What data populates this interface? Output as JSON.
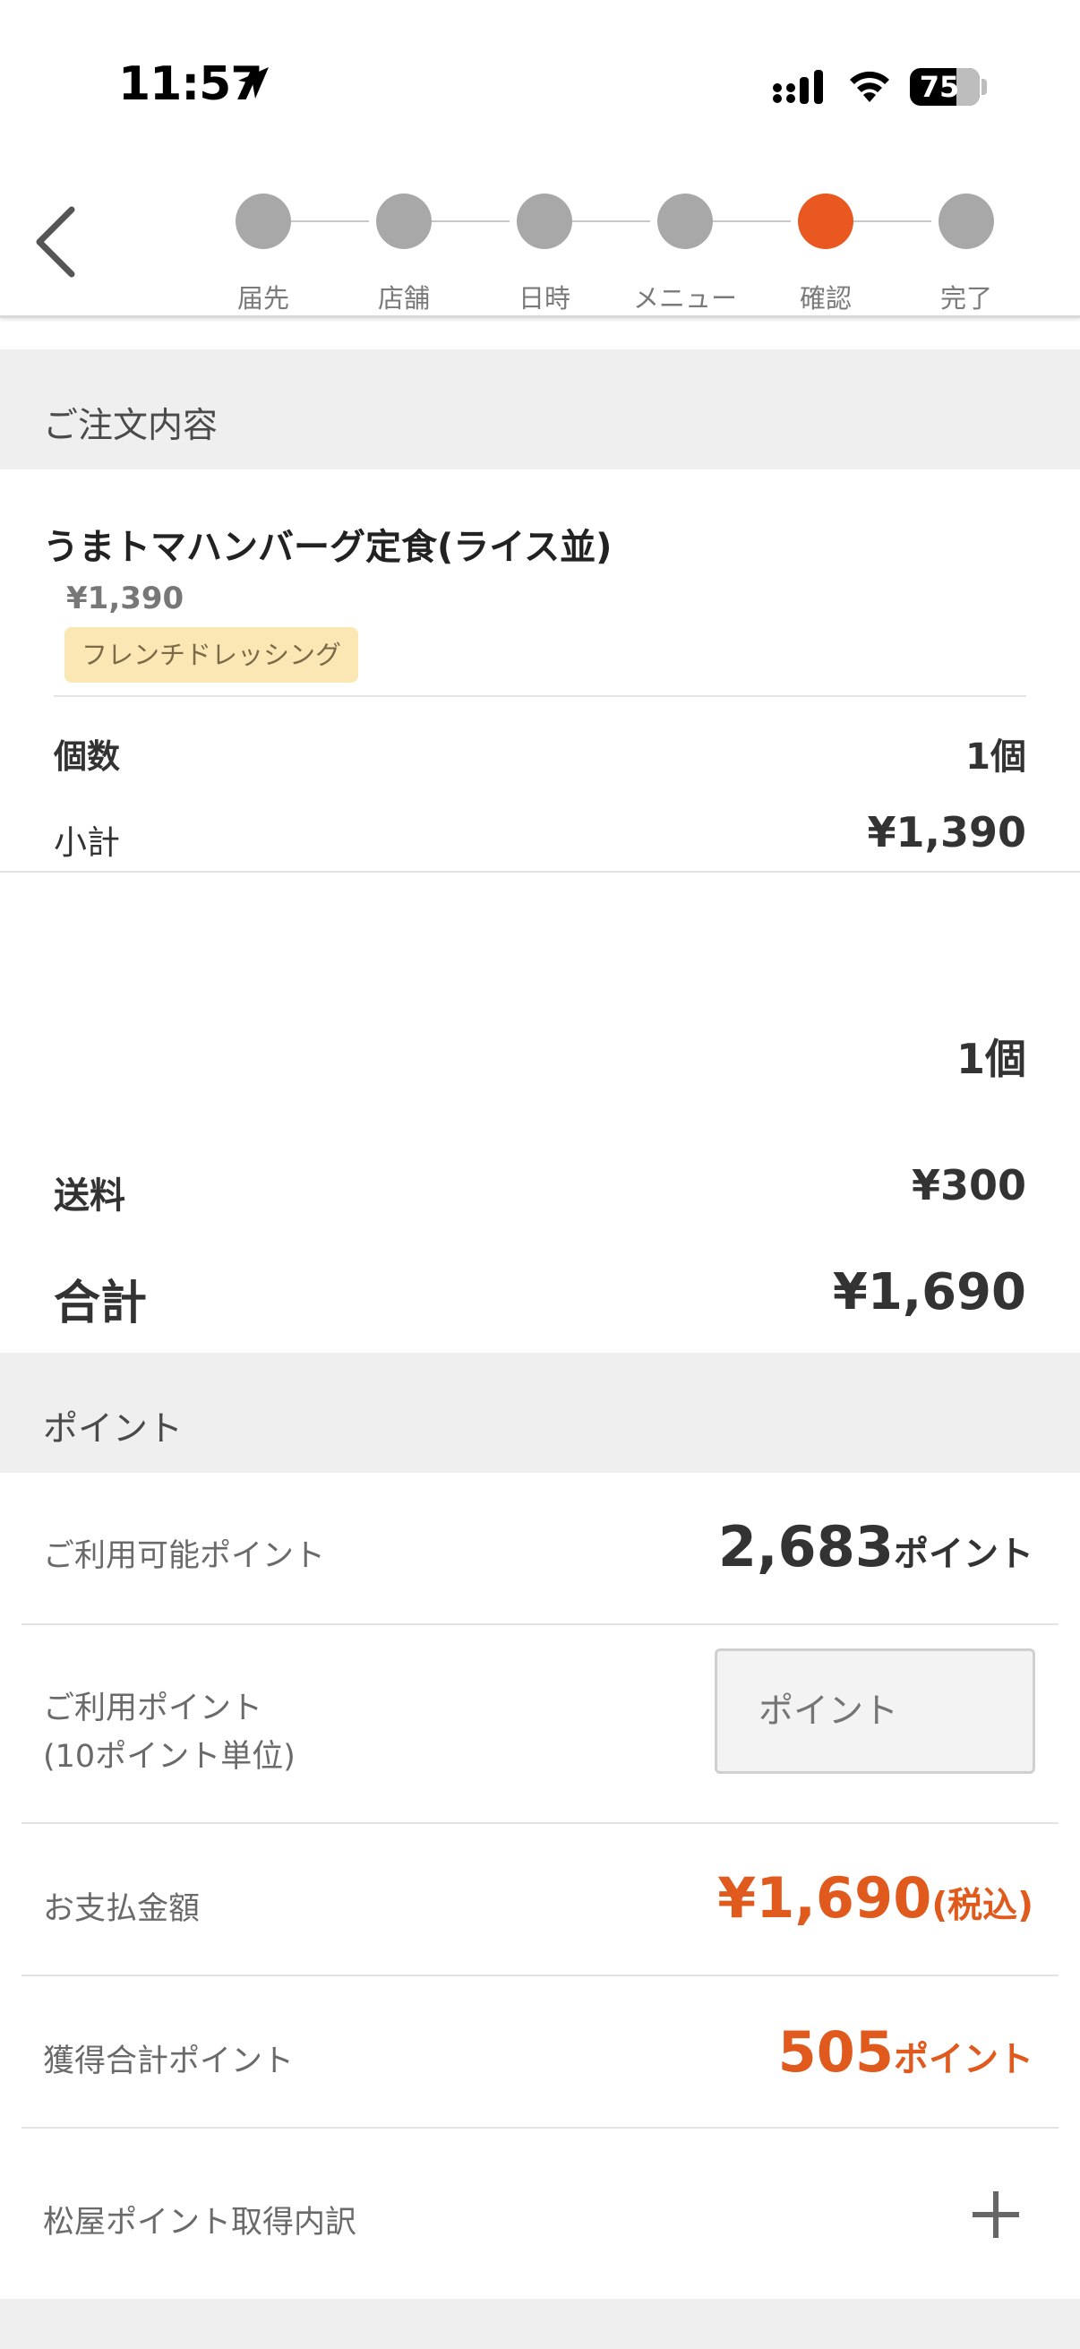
{
  "status_bar": {
    "time": "11:57",
    "battery": "75"
  },
  "stepper": {
    "steps": [
      {
        "label": "届先",
        "active": false
      },
      {
        "label": "店舗",
        "active": false
      },
      {
        "label": "日時",
        "active": false
      },
      {
        "label": "メニュー",
        "active": false
      },
      {
        "label": "確認",
        "active": true
      },
      {
        "label": "完了",
        "active": false
      }
    ]
  },
  "order": {
    "section_title": "ご注文内容",
    "item": {
      "name": "うまトマハンバーグ定食(ライス並)",
      "price": "¥1,390",
      "option": "フレンチドレッシング"
    },
    "quantity_label": "個数",
    "quantity_value": "1個",
    "subtotal_label": "小計",
    "subtotal_value": "¥1,390",
    "total_count": "1個",
    "shipping_label": "送料",
    "shipping_value": "¥300",
    "total_label": "合計",
    "total_value": "¥1,690"
  },
  "points": {
    "section_title": "ポイント",
    "available_label": "ご利用可能ポイント",
    "available_value": "2,683",
    "available_unit": "ポイント",
    "use_label_line1": "ご利用ポイント",
    "use_label_line2": "(10ポイント単位)",
    "use_placeholder": "ポイント",
    "payment_label": "お支払金額",
    "payment_value": "¥1,690",
    "payment_suffix": "(税込)",
    "earned_label": "獲得合計ポイント",
    "earned_value": "505",
    "earned_unit": "ポイント",
    "breakdown_label": "松屋ポイント取得内訳"
  },
  "colors": {
    "accent": "#e95820",
    "inactive_step": "#a8a8a8",
    "section_bg": "#efefef",
    "option_tag": "#fbe7b3"
  }
}
